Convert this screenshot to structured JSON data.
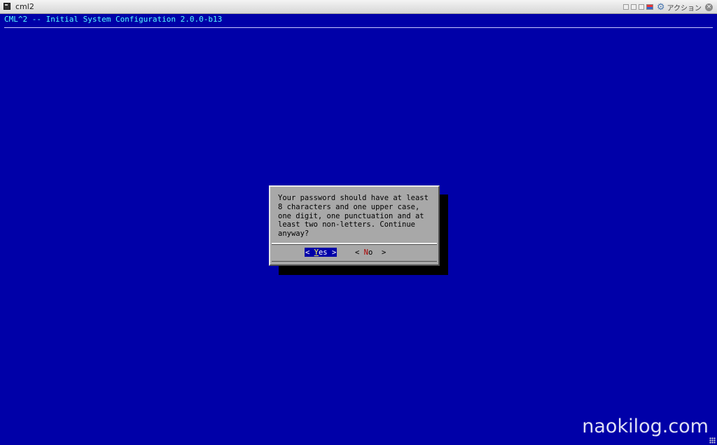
{
  "window": {
    "title": "cml2",
    "action_label": "アクション",
    "icons": [
      "minimize-icon",
      "restore-icon",
      "maximize-icon",
      "flag-icon",
      "gear-icon",
      "close-icon"
    ]
  },
  "terminal": {
    "header": "CML^2 -- Initial System Configuration 2.0.0-b13"
  },
  "dialog": {
    "message_lines": [
      "Your password should have at least",
      "8 characters and one upper case,",
      "one digit, one punctuation and at",
      "least two non-letters. Continue",
      "anyway?"
    ],
    "yes_button": {
      "left": "< ",
      "hotkey": "Y",
      "rest": "es >"
    },
    "no_button": {
      "left": "< ",
      "hotkey": "N",
      "rest": "o  >"
    }
  },
  "watermark": "naokilog.com",
  "colors": {
    "terminal_bg": "#0000a8",
    "header_text": "#55ffff",
    "dialog_bg": "#a8a8a8",
    "selected_button_bg": "#0000a8",
    "hotkey_red": "#a80000"
  }
}
